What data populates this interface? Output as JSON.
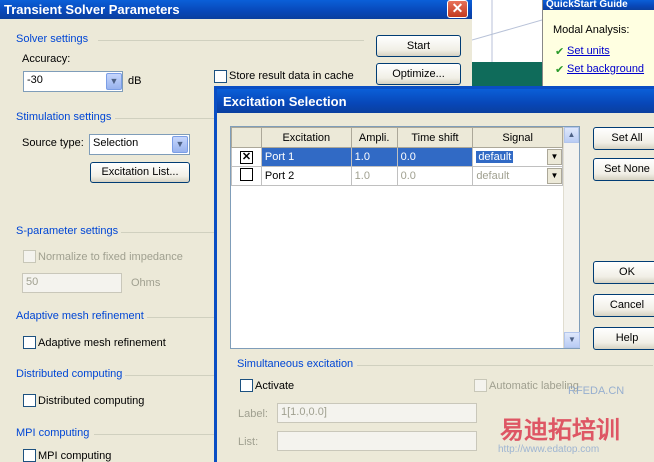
{
  "main_window": {
    "title": "Transient Solver Parameters",
    "solver_settings": {
      "label": "Solver settings",
      "accuracy_label": "Accuracy:",
      "accuracy_value": "-30",
      "accuracy_unit": "dB"
    },
    "store_result_label": "Store result data in cache",
    "start_button": "Start",
    "optimize_button": "Optimize...",
    "stimulation": {
      "label": "Stimulation settings",
      "source_type_label": "Source type:",
      "source_type_value": "Selection",
      "excitation_list_button": "Excitation List..."
    },
    "sparam": {
      "label": "S-parameter settings",
      "normalize_label": "Normalize to fixed impedance",
      "impedance_value": "50",
      "impedance_unit": "Ohms"
    },
    "adaptive": {
      "label": "Adaptive mesh refinement",
      "checkbox_label": "Adaptive mesh refinement"
    },
    "distributed": {
      "label": "Distributed computing",
      "checkbox_label": "Distributed computing"
    },
    "mpi": {
      "label": "MPI computing",
      "checkbox_label": "MPI computing"
    }
  },
  "quickstart": {
    "title": "QuickStart Guide",
    "heading": "Modal Analysis:",
    "links": [
      "Set units",
      "Set background"
    ]
  },
  "dialog": {
    "title": "Excitation Selection",
    "columns": [
      "Excitation",
      "Ampli.",
      "Time shift",
      "Signal"
    ],
    "rows": [
      {
        "checked": true,
        "name": "Port 1",
        "ampli": "1.0",
        "time_shift": "0.0",
        "signal": "default"
      },
      {
        "checked": false,
        "name": "Port 2",
        "ampli": "1.0",
        "time_shift": "0.0",
        "signal": "default"
      }
    ],
    "set_all": "Set All",
    "set_none": "Set None",
    "ok": "OK",
    "cancel": "Cancel",
    "help": "Help",
    "simultaneous": {
      "label": "Simultaneous excitation",
      "activate_label": "Activate",
      "auto_label": "Automatic labeling",
      "label_field_label": "Label:",
      "label_value": "1[1.0,0.0]",
      "list_field_label": "List:"
    }
  },
  "watermark": {
    "text1": "RFEDA.CN",
    "text2": "易迪拓培训",
    "text3": "http://www.edatop.com"
  }
}
